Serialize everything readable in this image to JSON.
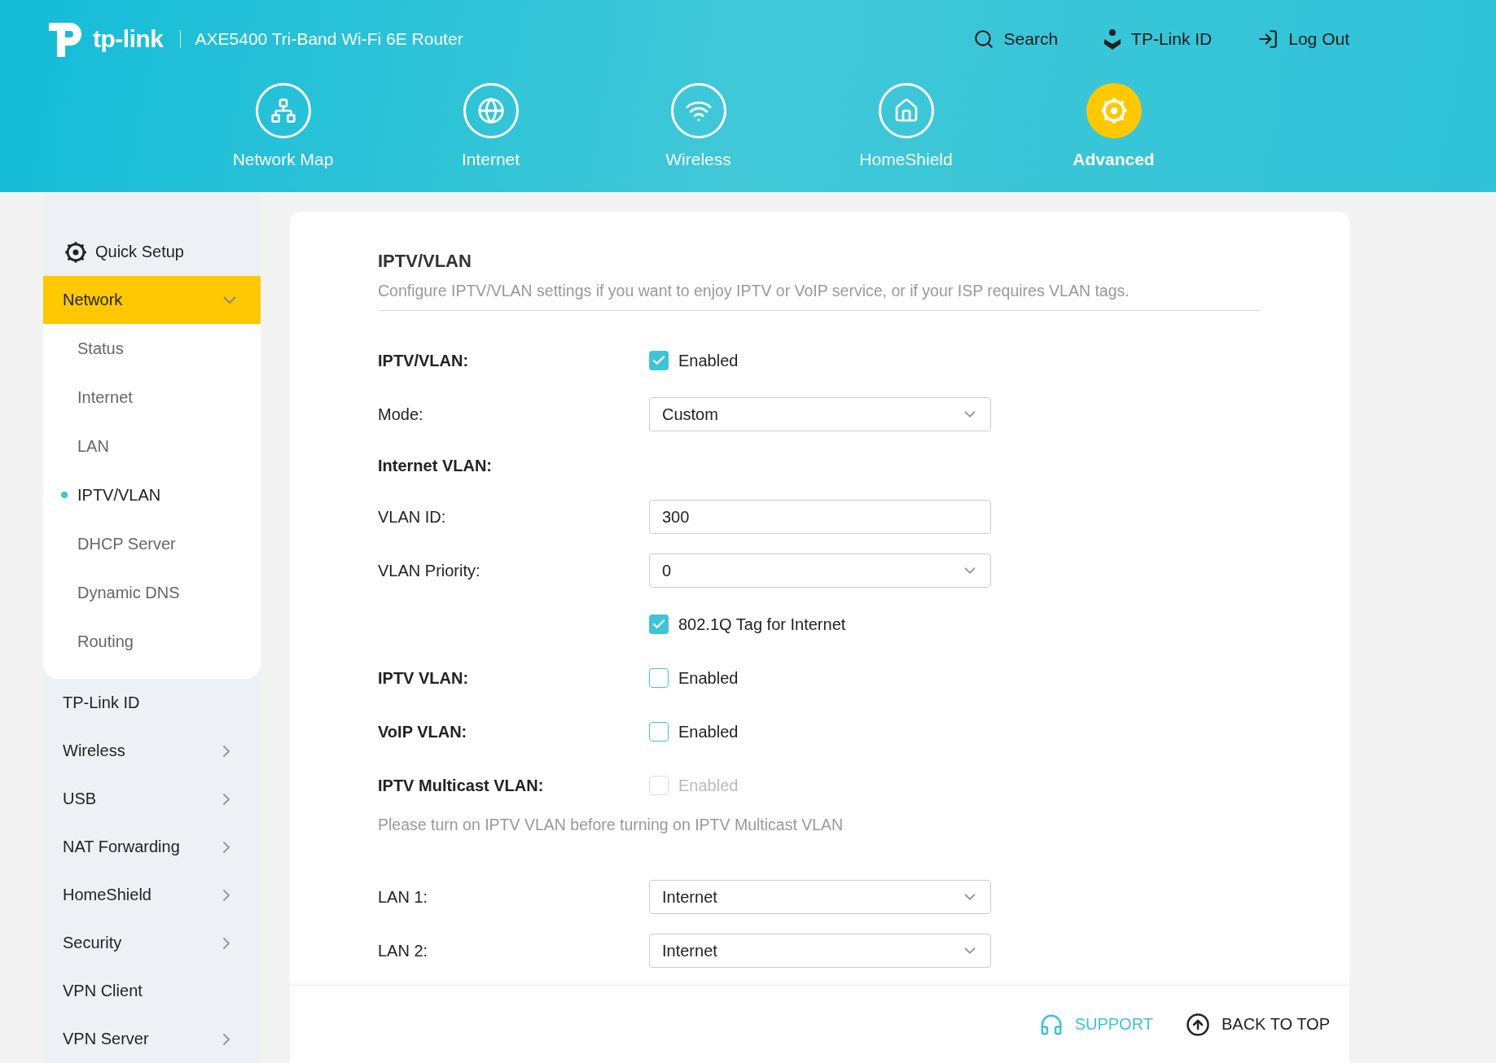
{
  "header": {
    "logo": "tp-link",
    "product": "AXE5400 Tri-Band Wi-Fi 6E Router",
    "top_links": [
      {
        "kind": "search",
        "label": "Search"
      },
      {
        "kind": "account",
        "label": "TP-Link ID"
      },
      {
        "kind": "logout",
        "label": "Log Out"
      }
    ],
    "nav_tabs": [
      {
        "kind": "map",
        "label": "Network Map",
        "selected": false
      },
      {
        "kind": "internet",
        "label": "Internet",
        "selected": false
      },
      {
        "kind": "wireless",
        "label": "Wireless",
        "selected": false
      },
      {
        "kind": "homeshield",
        "label": "HomeShield",
        "selected": false
      },
      {
        "kind": "advanced",
        "label": "Advanced",
        "selected": true
      }
    ]
  },
  "sidebar": {
    "quick_setup": "Quick Setup",
    "items": [
      {
        "label": "Network",
        "submenu": true,
        "expanded": true,
        "children": [
          {
            "label": "Status",
            "selected": false
          },
          {
            "label": "Internet",
            "selected": false
          },
          {
            "label": "LAN",
            "selected": false
          },
          {
            "label": "IPTV/VLAN",
            "selected": true
          },
          {
            "label": "DHCP Server",
            "selected": false
          },
          {
            "label": "Dynamic DNS",
            "selected": false
          },
          {
            "label": "Routing",
            "selected": false
          }
        ]
      },
      {
        "label": "TP-Link ID",
        "submenu": false,
        "expanded": false
      },
      {
        "label": "Wireless",
        "submenu": true,
        "expanded": false
      },
      {
        "label": "USB",
        "submenu": true,
        "expanded": false
      },
      {
        "label": "NAT Forwarding",
        "submenu": true,
        "expanded": false
      },
      {
        "label": "HomeShield",
        "submenu": true,
        "expanded": false
      },
      {
        "label": "Security",
        "submenu": true,
        "expanded": false
      },
      {
        "label": "VPN Client",
        "submenu": false,
        "expanded": false
      },
      {
        "label": "VPN Server",
        "submenu": true,
        "expanded": false
      }
    ]
  },
  "content": {
    "title": "IPTV/VLAN",
    "description": "Configure IPTV/VLAN settings if you want to enjoy IPTV or VoIP service, or if your ISP requires VLAN tags.",
    "rows": [
      {
        "kind": "checkbox",
        "label": "IPTV/VLAN:",
        "option": "Enabled",
        "checked": true,
        "disabled": false
      },
      {
        "kind": "select",
        "label": "Mode:",
        "value": "Custom"
      },
      {
        "kind": "heading",
        "label": "Internet VLAN:"
      },
      {
        "kind": "input",
        "label": "VLAN ID:",
        "value": "300"
      },
      {
        "kind": "select",
        "label": "VLAN Priority:",
        "value": "0"
      },
      {
        "kind": "checkbox",
        "option": "802.1Q Tag for Internet",
        "checked": true,
        "disabled": false
      },
      {
        "kind": "checkbox",
        "label": "IPTV VLAN:",
        "option": "Enabled",
        "checked": false,
        "disabled": false
      },
      {
        "kind": "checkbox",
        "label": "VoIP VLAN:",
        "option": "Enabled",
        "checked": false,
        "disabled": false
      },
      {
        "kind": "checkbox",
        "label": "IPTV Multicast VLAN:",
        "option": "Enabled",
        "checked": false,
        "disabled": true
      },
      {
        "kind": "hint",
        "text": "Please turn on IPTV VLAN before turning on IPTV Multicast VLAN"
      },
      {
        "kind": "select",
        "label": "LAN 1:",
        "value": "Internet"
      },
      {
        "kind": "select",
        "label": "LAN 2:",
        "value": "Internet"
      }
    ]
  },
  "footer": {
    "support": "SUPPORT",
    "back_to_top": "BACK TO TOP"
  }
}
